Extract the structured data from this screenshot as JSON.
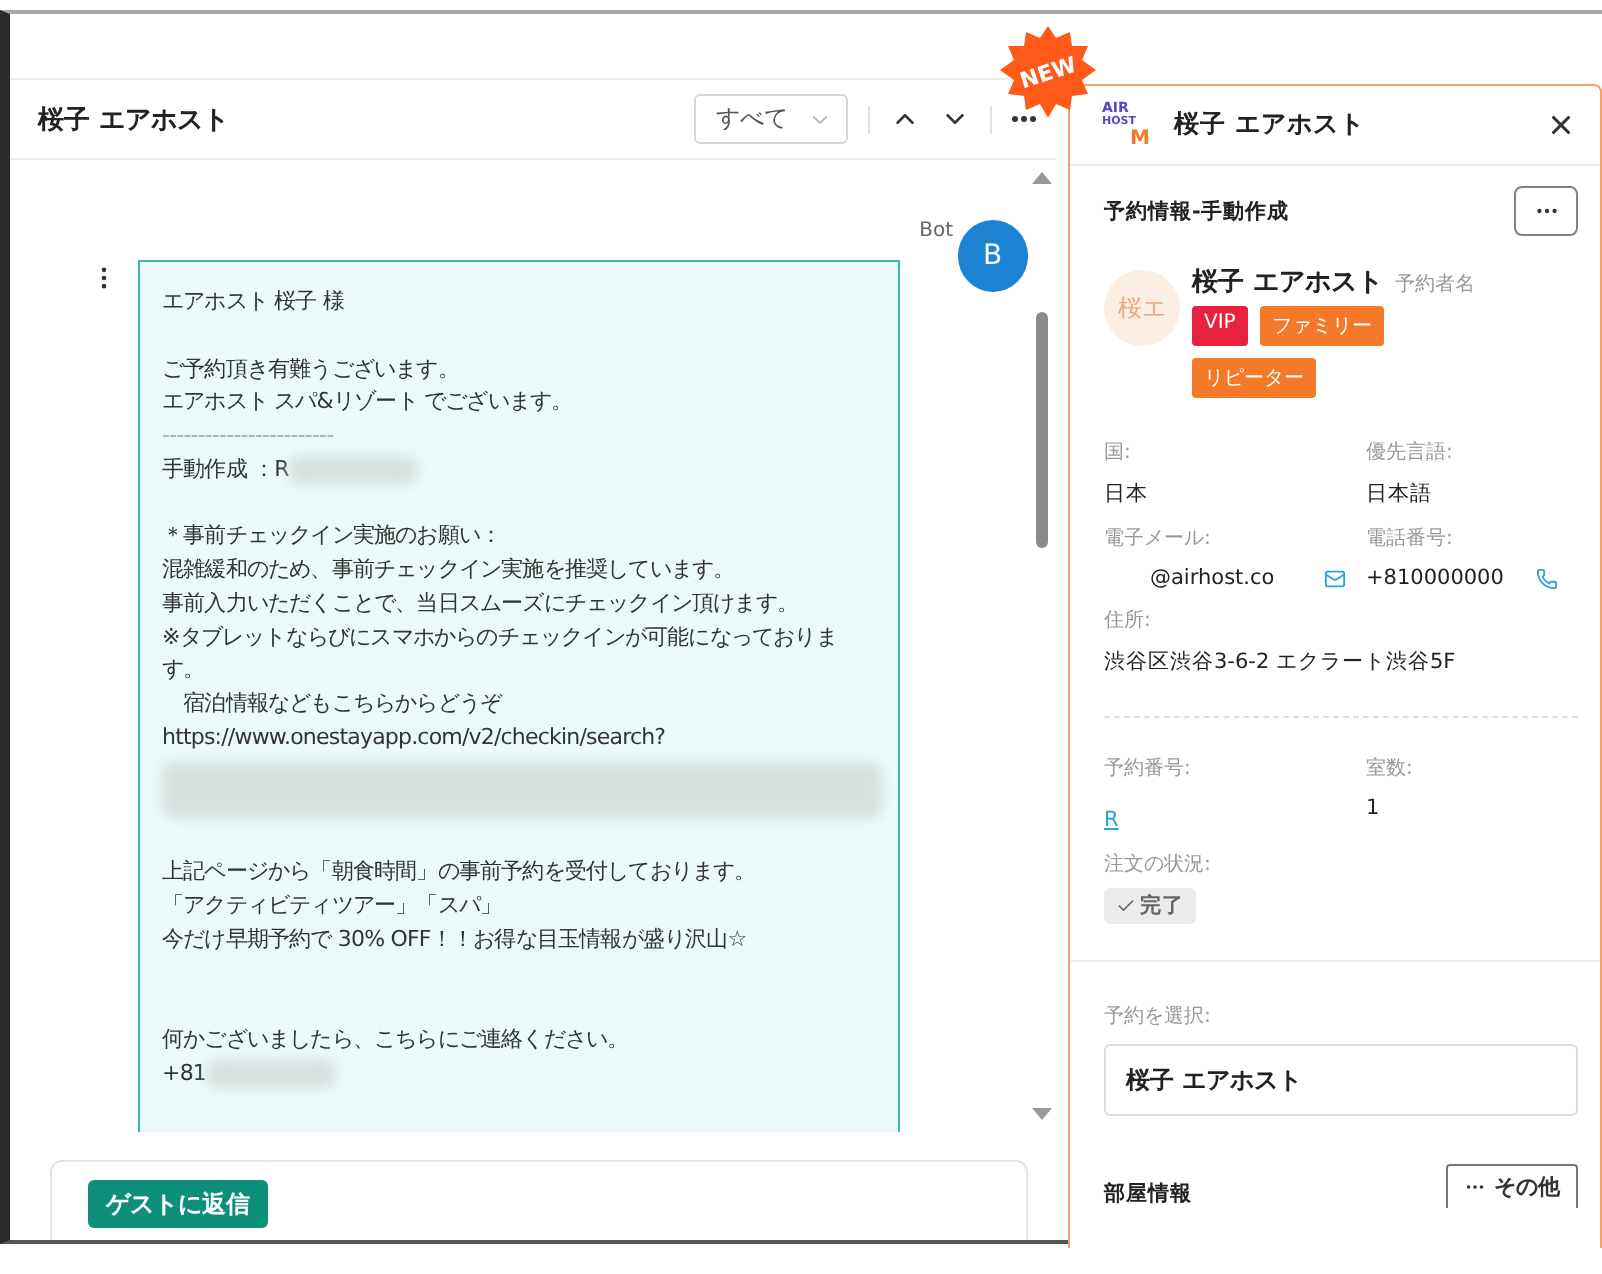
{
  "conversation": {
    "title": "桜子 エアホスト",
    "filter": {
      "value": "すべて"
    },
    "message": {
      "sender": "Bot",
      "avatar": "B",
      "lines": [
        {
          "kind": "text",
          "text": "エアホスト 桜子 様"
        },
        {
          "kind": "space"
        },
        {
          "kind": "text",
          "text": "ご予約頂き有難うございます。"
        },
        {
          "kind": "text",
          "text": "エアホスト スパ&リゾート でございます。"
        },
        {
          "kind": "rule",
          "text": "------------------------"
        },
        {
          "kind": "masked",
          "text": "手動作成 ：R"
        },
        {
          "kind": "space"
        },
        {
          "kind": "text",
          "text": "＊事前チェックイン実施のお願い："
        },
        {
          "kind": "text",
          "text": "混雑緩和のため、事前チェックイン実施を推奨しています。"
        },
        {
          "kind": "text",
          "text": "事前入力いただくことで、当日スムーズにチェックイン頂けます。"
        },
        {
          "kind": "text",
          "text": "※タブレットならびにスマホからのチェックインが可能になっておりま"
        },
        {
          "kind": "text",
          "text": "す。"
        },
        {
          "kind": "text",
          "text": "　宿泊情報などもこちらからどうぞ"
        },
        {
          "kind": "text",
          "text": "https://www.onestayapp.com/v2/checkin/search?"
        },
        {
          "kind": "mask"
        },
        {
          "kind": "space"
        },
        {
          "kind": "text",
          "text": "上記ページから「朝食時間」の事前予約を受付しております。"
        },
        {
          "kind": "text",
          "text": "「アクティビティツアー」「スパ」"
        },
        {
          "kind": "text",
          "text": "今だけ早期予約で 30% OFF！！お得な目玉情報が盛り沢山☆"
        },
        {
          "kind": "space"
        },
        {
          "kind": "space"
        },
        {
          "kind": "text",
          "text": "何かございましたら、こちらにご連絡ください。"
        },
        {
          "kind": "masked",
          "text": "+81"
        }
      ]
    },
    "reply_button": "ゲストに返信"
  },
  "new_badge": "NEW",
  "guest_panel": {
    "logo": {
      "line1": "AIR",
      "line2": "HOST",
      "mark": "M"
    },
    "title": "桜子 エアホスト",
    "section_title": "予約情報-手動作成",
    "guest": {
      "avatar": "桜エ",
      "name": "桜子 エアホスト",
      "role": "予約者名",
      "tags": [
        {
          "label": "VIP",
          "color": "#e8213f"
        },
        {
          "label": "ファミリー",
          "color": "#f47a2a"
        },
        {
          "label": "リピーター",
          "color": "#f47a2a"
        }
      ]
    },
    "fields": [
      {
        "label": "国:",
        "value": "日本"
      },
      {
        "label": "優先言語:",
        "value": "日本語"
      },
      {
        "label": "電子メール:",
        "value": "@airhost.co",
        "kind": "email"
      },
      {
        "label": "電話番号:",
        "value": "+810000000",
        "kind": "phone"
      }
    ],
    "address": {
      "label": "住所:",
      "value": "渋谷区渋谷3-6-2 エクラート渋谷5F"
    },
    "booking_number": {
      "label": "予約番号:",
      "value": "R"
    },
    "rooms": {
      "label": "室数:",
      "value": "1"
    },
    "order_status": {
      "label": "注文の状況:",
      "value": "完了"
    },
    "select_booking": {
      "label": "予約を選択:",
      "value": "桜子 エアホスト"
    },
    "room_info": {
      "title": "部屋情報",
      "more": "その他"
    }
  }
}
